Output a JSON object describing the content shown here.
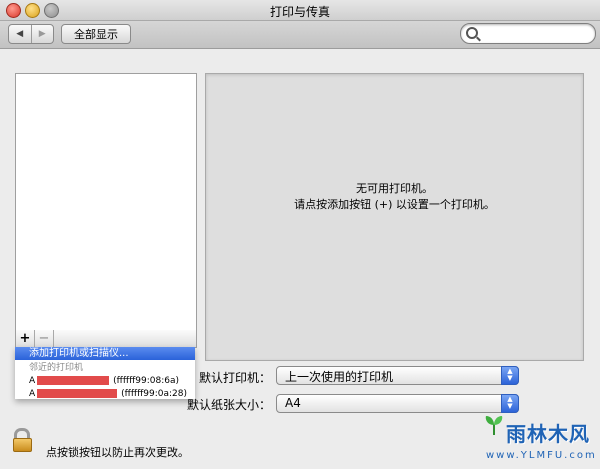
{
  "window": {
    "title": "打印与传真"
  },
  "toolbar": {
    "back_label": "◀",
    "forward_label": "▶",
    "show_all_label": "全部显示",
    "search_value": ""
  },
  "printer_list": {
    "add_label": "+",
    "remove_label": "−",
    "menu": {
      "add_item": "添加打印机或扫描仪...",
      "section": "邻近的打印机",
      "printers": [
        {
          "prefix": "A",
          "suffix": "(ffffff99:08:6a)"
        },
        {
          "prefix": "A",
          "suffix": "(ffffff99:0a:28)"
        }
      ]
    }
  },
  "detail": {
    "line1": "无可用打印机。",
    "line2": "请点按添加按钮 (+) 以设置一个打印机。"
  },
  "defaults": {
    "printer_label": "默认打印机：",
    "printer_value": "上一次使用的打印机",
    "paper_label": "默认纸张大小：",
    "paper_value": "A4"
  },
  "lock": {
    "text": "点按锁按钮以防止再次更改。"
  },
  "watermark": {
    "text": "雨林木风",
    "url": "www.YLMFU.com"
  },
  "colors": {
    "highlight": "#2a62d9",
    "redaction": "#e24b4b",
    "watermark": "#1f63b5"
  }
}
